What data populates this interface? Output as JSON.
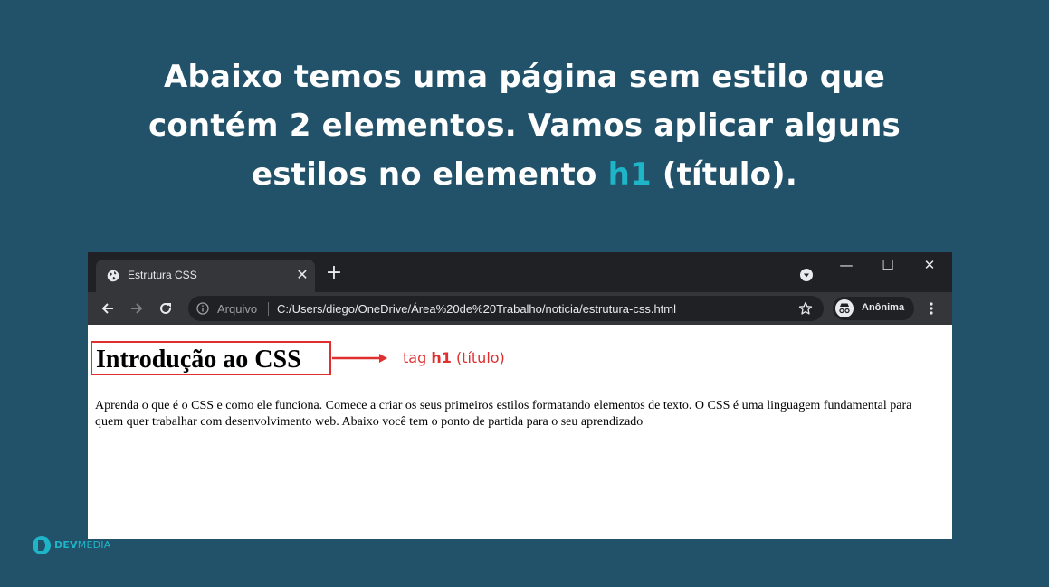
{
  "headline": {
    "line1": "Abaixo temos uma página sem estilo que",
    "line2": "contém 2 elementos. Vamos aplicar alguns",
    "line3_before": "estilos no elemento ",
    "line3_highlight": "h1",
    "line3_after": " (título)."
  },
  "browser": {
    "tab_title": "Estrutura CSS",
    "tab_close": "✕",
    "new_tab": "+",
    "window_controls": {
      "minimize": "—",
      "maximize": "☐",
      "close": "✕"
    },
    "omnibox": {
      "label": "Arquivo",
      "url": "C:/Users/diego/OneDrive/Área%20de%20Trabalho/noticia/estrutura-css.html"
    },
    "profile_label": "Anônima"
  },
  "page": {
    "h1": "Introdução ao CSS",
    "paragraph": "Aprenda o que é o CSS e como ele funciona. Comece a criar os seus primeiros estilos formatando elementos de texto. O CSS é uma linguagem fundamental para quem quer trabalhar com desenvolvimento web. Abaixo você tem o ponto de partida para o seu aprendizado"
  },
  "annotation": {
    "prefix": "tag ",
    "tag": "h1",
    "suffix": " (título)"
  },
  "logo": {
    "part1": "DEV",
    "part2": "MEDIA"
  },
  "colors": {
    "background": "#215269",
    "highlight": "#1fb5c9",
    "annotation": "#e02f2f",
    "browser_dark": "#202124",
    "browser_toolbar": "#35363a"
  },
  "icons": {
    "favicon": "globe-icon",
    "back": "arrow-left-icon",
    "forward": "arrow-right-icon",
    "reload": "reload-icon",
    "info": "info-icon",
    "bookmark": "star-icon",
    "incognito": "incognito-icon",
    "menu": "kebab-menu-icon"
  }
}
